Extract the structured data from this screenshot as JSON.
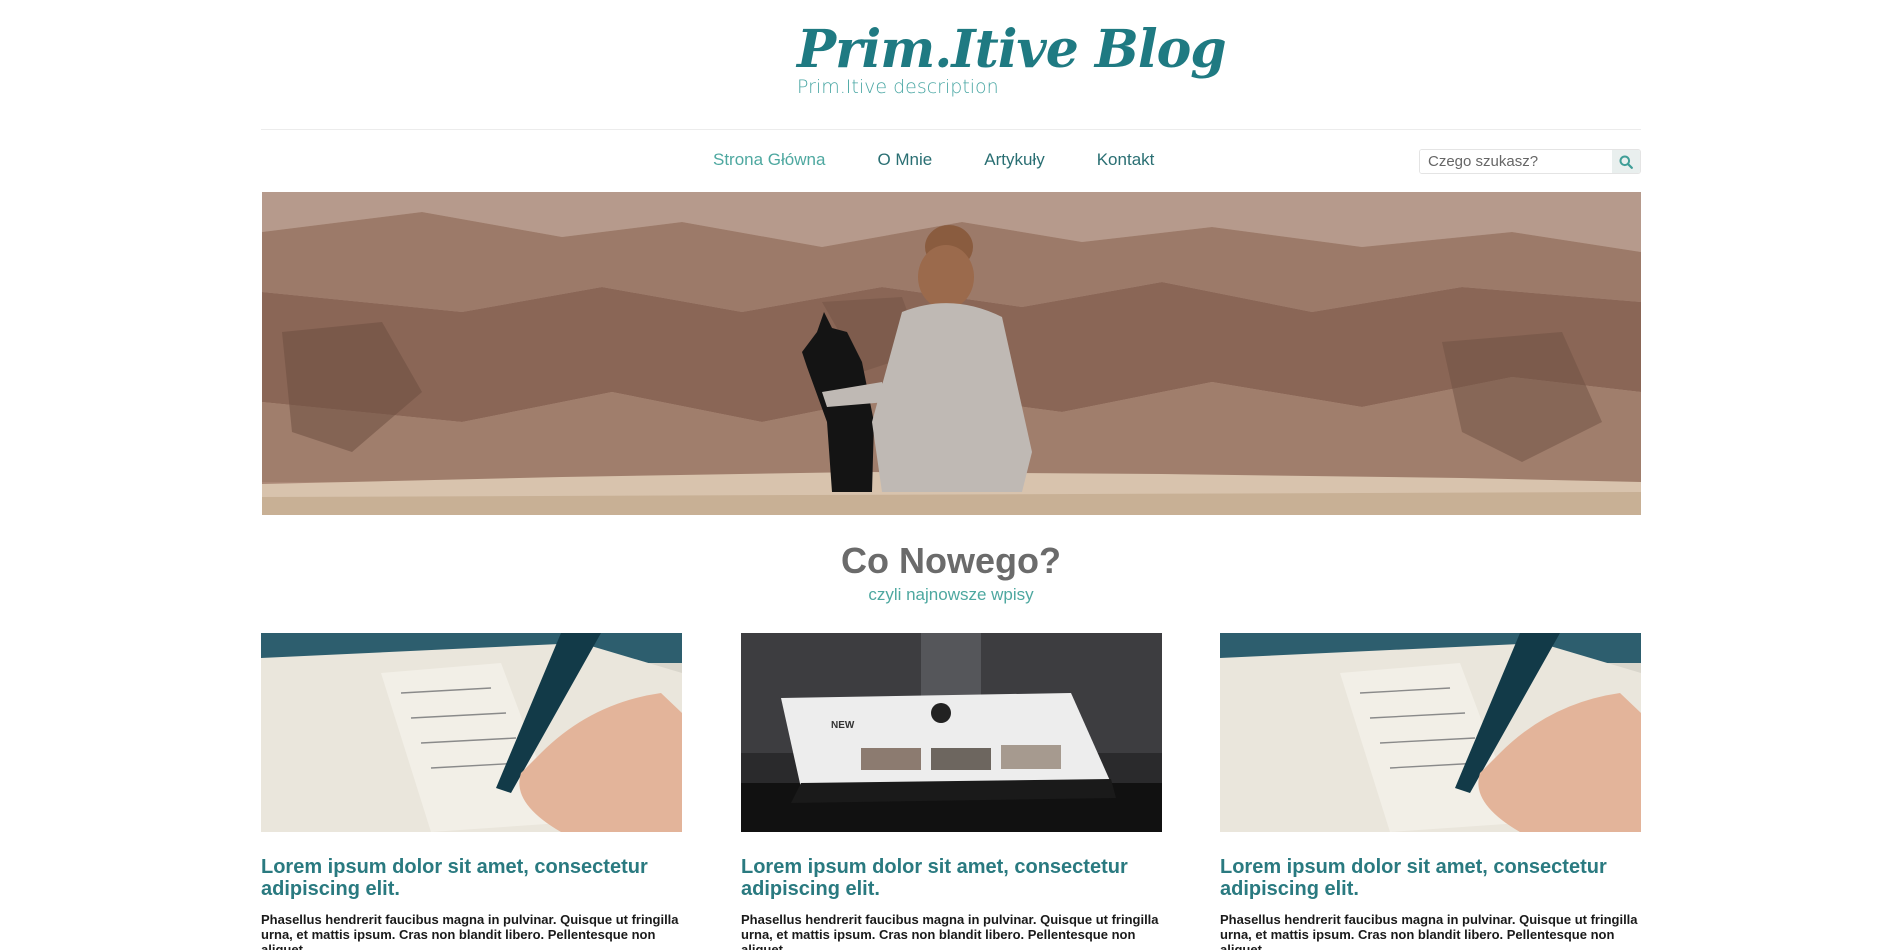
{
  "header": {
    "title": "Prim.Itive Blog",
    "description": "Prim.Itive description"
  },
  "nav": {
    "items": [
      {
        "label": "Strona Główna",
        "active": true
      },
      {
        "label": "O Mnie",
        "active": false
      },
      {
        "label": "Artykuły",
        "active": false
      },
      {
        "label": "Kontakt",
        "active": false
      }
    ]
  },
  "search": {
    "placeholder": "Czego szukasz?",
    "icon": "search-icon"
  },
  "hero": {
    "image": "woman-and-dog-overlooking-canyon"
  },
  "section": {
    "title": "Co Nowego?",
    "subtitle": "czyli najnowsze wpisy"
  },
  "posts": [
    {
      "image": "notebook-checklist-writing",
      "title": "Lorem ipsum dolor sit amet, consectetur adipiscing elit.",
      "excerpt": "Phasellus hendrerit faucibus magna in pulvinar. Quisque ut fringilla urna, et mattis ipsum. Cras non blandit libero. Pellentesque non aliquet"
    },
    {
      "image": "laptop-on-desk",
      "title": "Lorem ipsum dolor sit amet, consectetur adipiscing elit.",
      "excerpt": "Phasellus hendrerit faucibus magna in pulvinar. Quisque ut fringilla urna, et mattis ipsum. Cras non blandit libero. Pellentesque non aliquet"
    },
    {
      "image": "notebook-checklist-writing",
      "title": "Lorem ipsum dolor sit amet, consectetur adipiscing elit.",
      "excerpt": "Phasellus hendrerit faucibus magna in pulvinar. Quisque ut fringilla urna, et mattis ipsum. Cras non blandit libero. Pellentesque non aliquet"
    }
  ],
  "colors": {
    "brand": "#1f7a82",
    "accent": "#4ea8a0",
    "heading": "#6b6b6b"
  }
}
